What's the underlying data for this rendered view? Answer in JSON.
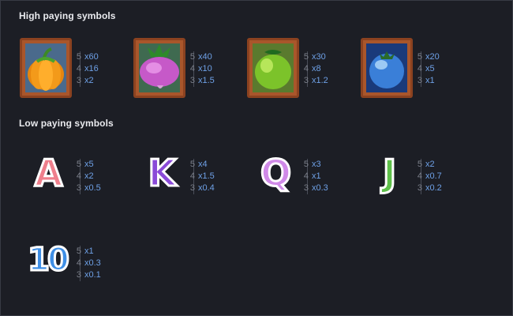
{
  "high_title": "High paying symbols",
  "low_title": "Low paying symbols",
  "colors": {
    "background": "#1c1e25",
    "multiplier": "#6ea0e6",
    "count": "#7c808b",
    "crate_wood": "#9a4a23"
  },
  "high_symbols": [
    {
      "name": "pumpkin",
      "icon": "pumpkin-icon",
      "pays": [
        {
          "count": "5",
          "mult": "x60"
        },
        {
          "count": "4",
          "mult": "x16"
        },
        {
          "count": "3",
          "mult": "x2"
        }
      ]
    },
    {
      "name": "turnip",
      "icon": "turnip-icon",
      "pays": [
        {
          "count": "5",
          "mult": "x40"
        },
        {
          "count": "4",
          "mult": "x10"
        },
        {
          "count": "3",
          "mult": "x1.5"
        }
      ]
    },
    {
      "name": "apple",
      "icon": "green-apple-icon",
      "pays": [
        {
          "count": "5",
          "mult": "x30"
        },
        {
          "count": "4",
          "mult": "x8"
        },
        {
          "count": "3",
          "mult": "x1.2"
        }
      ]
    },
    {
      "name": "blueberry",
      "icon": "blueberry-icon",
      "pays": [
        {
          "count": "5",
          "mult": "x20"
        },
        {
          "count": "4",
          "mult": "x5"
        },
        {
          "count": "3",
          "mult": "x1"
        }
      ]
    }
  ],
  "low_symbols": [
    {
      "label": "A",
      "color": "#ef7f8c",
      "icon": "letter-a-icon",
      "pays": [
        {
          "count": "5",
          "mult": "x5"
        },
        {
          "count": "4",
          "mult": "x2"
        },
        {
          "count": "3",
          "mult": "x0.5"
        }
      ]
    },
    {
      "label": "K",
      "color": "#8a4ad8",
      "icon": "letter-k-icon",
      "pays": [
        {
          "count": "5",
          "mult": "x4"
        },
        {
          "count": "4",
          "mult": "x1.5"
        },
        {
          "count": "3",
          "mult": "x0.4"
        }
      ]
    },
    {
      "label": "Q",
      "color": "#d08ae8",
      "icon": "letter-q-icon",
      "pays": [
        {
          "count": "5",
          "mult": "x3"
        },
        {
          "count": "4",
          "mult": "x1"
        },
        {
          "count": "3",
          "mult": "x0.3"
        }
      ]
    },
    {
      "label": "J",
      "color": "#5ec04a",
      "icon": "letter-j-icon",
      "pays": [
        {
          "count": "5",
          "mult": "x2"
        },
        {
          "count": "4",
          "mult": "x0.7"
        },
        {
          "count": "3",
          "mult": "x0.2"
        }
      ]
    },
    {
      "label": "10",
      "color": "#3f8fe6",
      "icon": "number-10-icon",
      "pays": [
        {
          "count": "5",
          "mult": "x1"
        },
        {
          "count": "4",
          "mult": "x0.3"
        },
        {
          "count": "3",
          "mult": "x0.1"
        }
      ]
    }
  ]
}
